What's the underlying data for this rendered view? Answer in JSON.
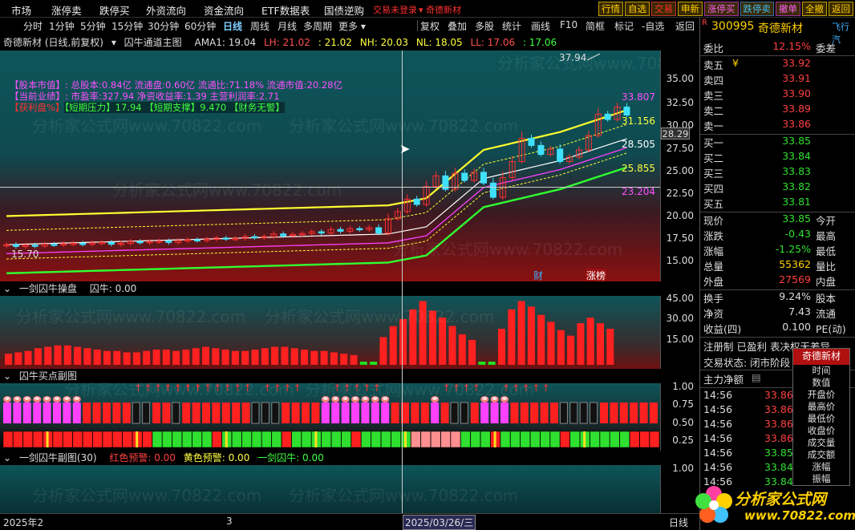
{
  "menu": [
    "市场",
    "涨停卖",
    "跌停买",
    "外资流向",
    "资金流向",
    "ETF数据表",
    "国债逆购"
  ],
  "trade_status": "交易未登录",
  "stock_badge": "奇德新材",
  "right_buttons": [
    "行情",
    "自选",
    "交易",
    "申新",
    "涨停买",
    "跌停卖",
    "撤单",
    "全撤",
    "返回"
  ],
  "timeframes": [
    "分时",
    "1分钟",
    "5分钟",
    "15分钟",
    "30分钟",
    "60分钟",
    "日线",
    "周线",
    "月线",
    "多周期",
    "更多"
  ],
  "active_timeframe": "日线",
  "tools": [
    "复权",
    "叠加",
    "多股",
    "统计",
    "画线",
    "F10",
    "简框",
    "标记",
    "-自选",
    "返回"
  ],
  "main_header": {
    "name": "奇德新材 (日线,前复权)",
    "indicator": "囚牛通道主图",
    "ama": "AMA1: 19.04",
    "lh": "LH: 21.02",
    "lh2": ": 21.02",
    "nh": "NH: 20.03",
    "nl": "NL: 18.05",
    "ll": "LL: 17.06",
    "ll2": ": 17.06"
  },
  "info_lines": [
    "【股本市值】: 总股本:0.84亿 流通盘:0.60亿 流通比:71.18% 流通市值:20.28亿",
    "【当前业绩】: 市盈率:327.94 净资收益率:1.39 主营利润率:2.71",
    "【短期压力】17.94 【短期支撑】9.470 【财务无警】"
  ],
  "info_prefix": "【获利盘%】",
  "levels": [
    "33.807",
    "31.156",
    "28.505",
    "25.855",
    "23.204"
  ],
  "peak_label": "37.94",
  "low_label": "15.70",
  "markers": [
    "财",
    "涨榜"
  ],
  "main_axis": [
    "35.00",
    "32.50",
    "30.00",
    "27.50",
    "25.00",
    "22.50",
    "20.00",
    "17.50",
    "15.00"
  ],
  "cursor_price": "28.29",
  "panel2_header": {
    "name": "一剑囚牛操盘",
    "value": "囚牛: 0.00"
  },
  "panel2_axis": [
    "45.00",
    "30.00",
    "15.00"
  ],
  "panel3_header": {
    "name": "囚牛买点副图"
  },
  "panel3_axis": [
    "1.00",
    "0.75",
    "0.50",
    "0.25"
  ],
  "panel4_header": {
    "name": "一剑囚牛副图(30)",
    "red": "红色预警: 0.00",
    "yellow": "黄色预警: 0.00",
    "bull": "一剑囚牛: 0.00"
  },
  "panel4_axis": [
    "1.00"
  ],
  "date_labels": [
    "2025年2",
    "3",
    "2025/03/26/三"
  ],
  "axis_bottom": "日线",
  "watermark": "分析家公式网www.70822.com",
  "quote": {
    "code": "300995",
    "name": "奇德新材",
    "flag": "R",
    "sideline": "飞行汽",
    "weibi": {
      "label": "委比",
      "value": "12.15%",
      "rlabel": "委差"
    },
    "asks": [
      {
        "label": "卖五",
        "price": "33.92"
      },
      {
        "label": "卖四",
        "price": "33.91"
      },
      {
        "label": "卖三",
        "price": "33.90"
      },
      {
        "label": "卖二",
        "price": "33.89"
      },
      {
        "label": "卖一",
        "price": "33.86"
      }
    ],
    "bids": [
      {
        "label": "买一",
        "price": "33.85"
      },
      {
        "label": "买二",
        "price": "33.84"
      },
      {
        "label": "买三",
        "price": "33.83"
      },
      {
        "label": "买四",
        "price": "33.82"
      },
      {
        "label": "买五",
        "price": "33.81"
      }
    ],
    "yen": "¥",
    "stats": [
      {
        "l": "现价",
        "v": "33.85",
        "r": "今开",
        "c": "#ff4040"
      },
      {
        "l": "涨跌",
        "v": "-0.43",
        "r": "最高",
        "c": "#30e030"
      },
      {
        "l": "涨幅",
        "v": "-1.25%",
        "r": "最低",
        "c": "#30e030"
      },
      {
        "l": "总量",
        "v": "55362",
        "r": "量比",
        "c": "#ffd000"
      },
      {
        "l": "外盘",
        "v": "27569",
        "r": "内盘",
        "c": "#ff4040"
      },
      {
        "l": "换手",
        "v": "9.24%",
        "r": "股本",
        "c": "#ddd"
      },
      {
        "l": "净资",
        "v": "7.43",
        "r": "流通",
        "c": "#ddd"
      },
      {
        "l": "收益(四)",
        "v": "0.100",
        "r": "PE(动)",
        "c": "#ddd"
      }
    ],
    "reg": "注册制 已盈利 表决权无差异",
    "status": "交易状态: 闭市阶段",
    "netflow": "主力净额",
    "ticks": [
      {
        "t": "14:56",
        "p": "33.86"
      },
      {
        "t": "14:56",
        "p": "33.86"
      },
      {
        "t": "14:56",
        "p": "33.86"
      },
      {
        "t": "14:56",
        "p": "33.86"
      },
      {
        "t": "14:56",
        "p": "33.85"
      },
      {
        "t": "14:56",
        "p": "33.84"
      },
      {
        "t": "14:56",
        "p": "33.84"
      }
    ]
  },
  "popup": {
    "title": "奇德新材",
    "items": [
      "时间",
      "数值",
      "开盘价",
      "最高价",
      "最低价",
      "收盘价",
      "成交量",
      "成交额",
      "涨幅",
      "振幅"
    ]
  },
  "logo": {
    "title": "分析家公式网",
    "url": "www.70822.com"
  }
}
